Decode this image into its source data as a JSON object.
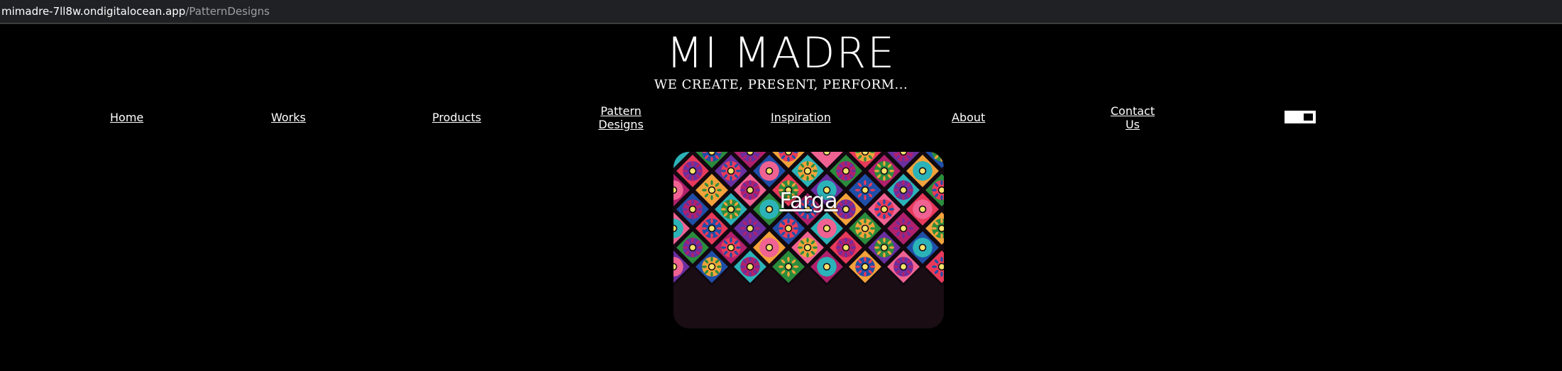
{
  "browser": {
    "url_domain": "mimadre-7ll8w.ondigitalocean.app",
    "url_path": "/PatternDesigns"
  },
  "header": {
    "title": "MI MADRE",
    "tagline": "WE CREATE, PRESENT, PERFORM..."
  },
  "nav": {
    "home": "Home",
    "works": "Works",
    "products": "Products",
    "pattern_line1": "Pattern",
    "pattern_line2": "Designs",
    "inspiration": "Inspiration",
    "about": "About",
    "contact_line1": "Contact",
    "contact_line2": "Us"
  },
  "theme_toggle": {
    "state": "on"
  },
  "gallery": {
    "items": [
      {
        "label": "Farga"
      }
    ]
  },
  "colors": {
    "background": "#000000",
    "text": "#ffffff",
    "tile_palette": [
      "#e83a5a",
      "#2bb3b8",
      "#f2a23a",
      "#6a2fa0",
      "#2a8c3c",
      "#f06292",
      "#1f4fa8",
      "#b0206c"
    ]
  }
}
